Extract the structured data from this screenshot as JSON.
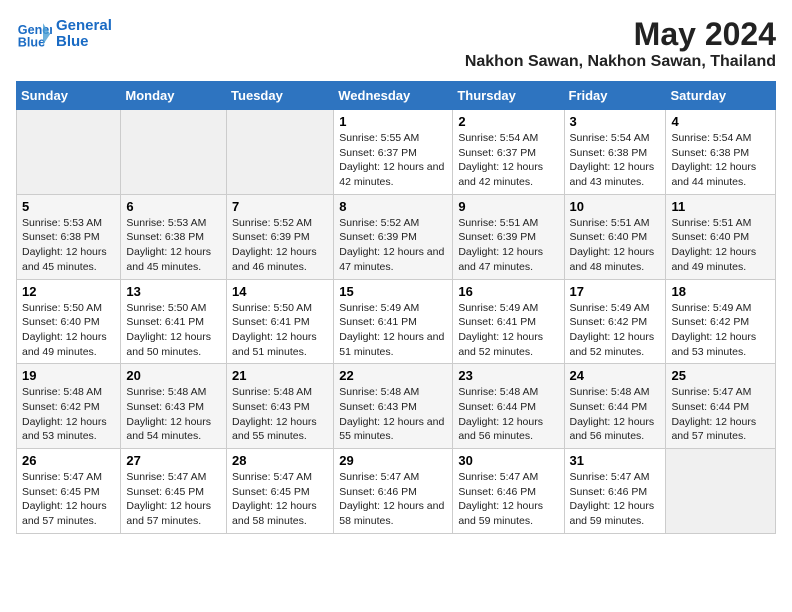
{
  "header": {
    "logo_line1": "General",
    "logo_line2": "Blue",
    "main_title": "May 2024",
    "subtitle": "Nakhon Sawan, Nakhon Sawan, Thailand"
  },
  "days_of_week": [
    "Sunday",
    "Monday",
    "Tuesday",
    "Wednesday",
    "Thursday",
    "Friday",
    "Saturday"
  ],
  "weeks": [
    [
      {
        "day": "",
        "sunrise": "",
        "sunset": "",
        "daylight": ""
      },
      {
        "day": "",
        "sunrise": "",
        "sunset": "",
        "daylight": ""
      },
      {
        "day": "",
        "sunrise": "",
        "sunset": "",
        "daylight": ""
      },
      {
        "day": "1",
        "sunrise": "5:55 AM",
        "sunset": "6:37 PM",
        "daylight": "12 hours and 42 minutes."
      },
      {
        "day": "2",
        "sunrise": "5:54 AM",
        "sunset": "6:37 PM",
        "daylight": "12 hours and 42 minutes."
      },
      {
        "day": "3",
        "sunrise": "5:54 AM",
        "sunset": "6:38 PM",
        "daylight": "12 hours and 43 minutes."
      },
      {
        "day": "4",
        "sunrise": "5:54 AM",
        "sunset": "6:38 PM",
        "daylight": "12 hours and 44 minutes."
      }
    ],
    [
      {
        "day": "5",
        "sunrise": "5:53 AM",
        "sunset": "6:38 PM",
        "daylight": "12 hours and 45 minutes."
      },
      {
        "day": "6",
        "sunrise": "5:53 AM",
        "sunset": "6:38 PM",
        "daylight": "12 hours and 45 minutes."
      },
      {
        "day": "7",
        "sunrise": "5:52 AM",
        "sunset": "6:39 PM",
        "daylight": "12 hours and 46 minutes."
      },
      {
        "day": "8",
        "sunrise": "5:52 AM",
        "sunset": "6:39 PM",
        "daylight": "12 hours and 47 minutes."
      },
      {
        "day": "9",
        "sunrise": "5:51 AM",
        "sunset": "6:39 PM",
        "daylight": "12 hours and 47 minutes."
      },
      {
        "day": "10",
        "sunrise": "5:51 AM",
        "sunset": "6:40 PM",
        "daylight": "12 hours and 48 minutes."
      },
      {
        "day": "11",
        "sunrise": "5:51 AM",
        "sunset": "6:40 PM",
        "daylight": "12 hours and 49 minutes."
      }
    ],
    [
      {
        "day": "12",
        "sunrise": "5:50 AM",
        "sunset": "6:40 PM",
        "daylight": "12 hours and 49 minutes."
      },
      {
        "day": "13",
        "sunrise": "5:50 AM",
        "sunset": "6:41 PM",
        "daylight": "12 hours and 50 minutes."
      },
      {
        "day": "14",
        "sunrise": "5:50 AM",
        "sunset": "6:41 PM",
        "daylight": "12 hours and 51 minutes."
      },
      {
        "day": "15",
        "sunrise": "5:49 AM",
        "sunset": "6:41 PM",
        "daylight": "12 hours and 51 minutes."
      },
      {
        "day": "16",
        "sunrise": "5:49 AM",
        "sunset": "6:41 PM",
        "daylight": "12 hours and 52 minutes."
      },
      {
        "day": "17",
        "sunrise": "5:49 AM",
        "sunset": "6:42 PM",
        "daylight": "12 hours and 52 minutes."
      },
      {
        "day": "18",
        "sunrise": "5:49 AM",
        "sunset": "6:42 PM",
        "daylight": "12 hours and 53 minutes."
      }
    ],
    [
      {
        "day": "19",
        "sunrise": "5:48 AM",
        "sunset": "6:42 PM",
        "daylight": "12 hours and 53 minutes."
      },
      {
        "day": "20",
        "sunrise": "5:48 AM",
        "sunset": "6:43 PM",
        "daylight": "12 hours and 54 minutes."
      },
      {
        "day": "21",
        "sunrise": "5:48 AM",
        "sunset": "6:43 PM",
        "daylight": "12 hours and 55 minutes."
      },
      {
        "day": "22",
        "sunrise": "5:48 AM",
        "sunset": "6:43 PM",
        "daylight": "12 hours and 55 minutes."
      },
      {
        "day": "23",
        "sunrise": "5:48 AM",
        "sunset": "6:44 PM",
        "daylight": "12 hours and 56 minutes."
      },
      {
        "day": "24",
        "sunrise": "5:48 AM",
        "sunset": "6:44 PM",
        "daylight": "12 hours and 56 minutes."
      },
      {
        "day": "25",
        "sunrise": "5:47 AM",
        "sunset": "6:44 PM",
        "daylight": "12 hours and 57 minutes."
      }
    ],
    [
      {
        "day": "26",
        "sunrise": "5:47 AM",
        "sunset": "6:45 PM",
        "daylight": "12 hours and 57 minutes."
      },
      {
        "day": "27",
        "sunrise": "5:47 AM",
        "sunset": "6:45 PM",
        "daylight": "12 hours and 57 minutes."
      },
      {
        "day": "28",
        "sunrise": "5:47 AM",
        "sunset": "6:45 PM",
        "daylight": "12 hours and 58 minutes."
      },
      {
        "day": "29",
        "sunrise": "5:47 AM",
        "sunset": "6:46 PM",
        "daylight": "12 hours and 58 minutes."
      },
      {
        "day": "30",
        "sunrise": "5:47 AM",
        "sunset": "6:46 PM",
        "daylight": "12 hours and 59 minutes."
      },
      {
        "day": "31",
        "sunrise": "5:47 AM",
        "sunset": "6:46 PM",
        "daylight": "12 hours and 59 minutes."
      },
      {
        "day": "",
        "sunrise": "",
        "sunset": "",
        "daylight": ""
      }
    ]
  ],
  "labels": {
    "sunrise": "Sunrise:",
    "sunset": "Sunset:",
    "daylight": "Daylight:"
  }
}
